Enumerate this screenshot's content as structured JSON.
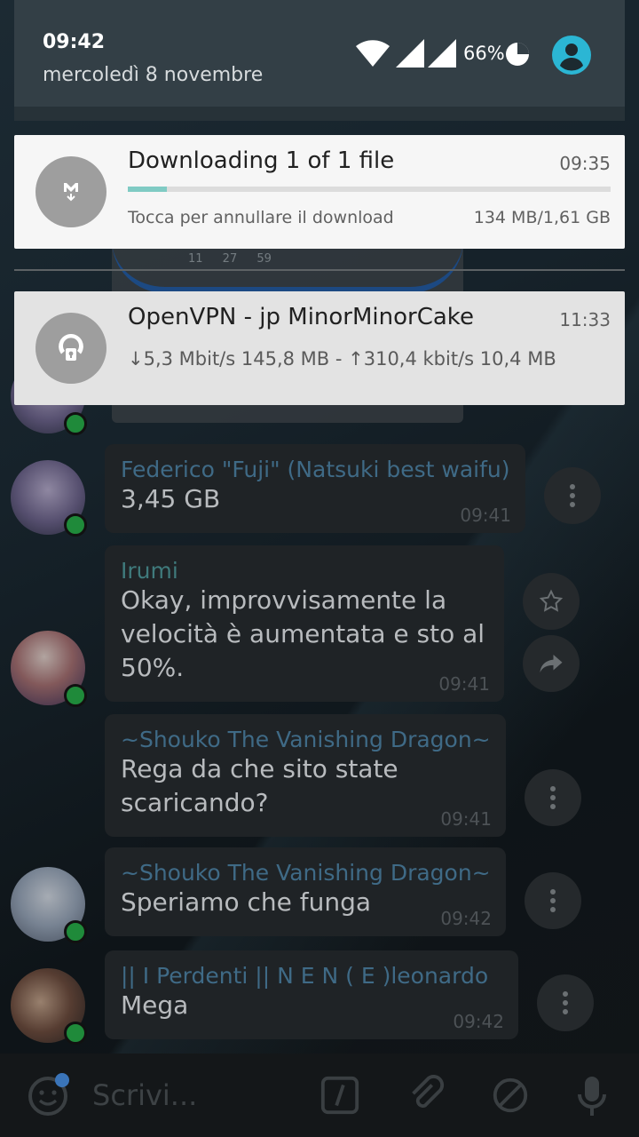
{
  "status_bar": {
    "time": "09:42",
    "date": "mercoledì 8 novembre",
    "battery": "66%"
  },
  "notifications": {
    "download": {
      "title": "Downloading 1 of 1 file",
      "time": "09:35",
      "subtitle": "Tocca per annullare il download",
      "size": "134 MB/1,61 GB",
      "progress_fraction": 0.08,
      "icon": "mega-download-icon"
    },
    "vpn": {
      "title": "OpenVPN - jp MinorMinorCake",
      "time": "11:33",
      "stats": "↓5,3 Mbit/s 145,8 MB - ↑310,4 kbit/s 10,4 MB",
      "icon": "openvpn-icon"
    }
  },
  "background_chat": {
    "shared_card_stats": "11 27 59",
    "messages": [
      {
        "author": "Federico \"Fuji\" (Natsuki best waifu)",
        "text": "3,45 GB",
        "time": "09:41"
      },
      {
        "author": "Irumi",
        "text": "Okay, improvvisamente la velocità è aumentata e sto al 50%.",
        "time": "09:41"
      },
      {
        "author": "~Shouko The Vanishing Dragon~",
        "text": "Rega da che sito state scaricando?",
        "time": "09:41"
      },
      {
        "author": "~Shouko The Vanishing Dragon~",
        "text": "Speriamo che funga",
        "time": "09:42"
      },
      {
        "author": "|| I Perdenti || N E N ( E )leonardo",
        "text": "Mega",
        "time": "09:42"
      }
    ],
    "input_placeholder": "Scrivi..."
  },
  "colors": {
    "accent_teal": "#80cbc4",
    "profile_blue": "#2bb6d4",
    "online_green": "#1f8a3a"
  }
}
